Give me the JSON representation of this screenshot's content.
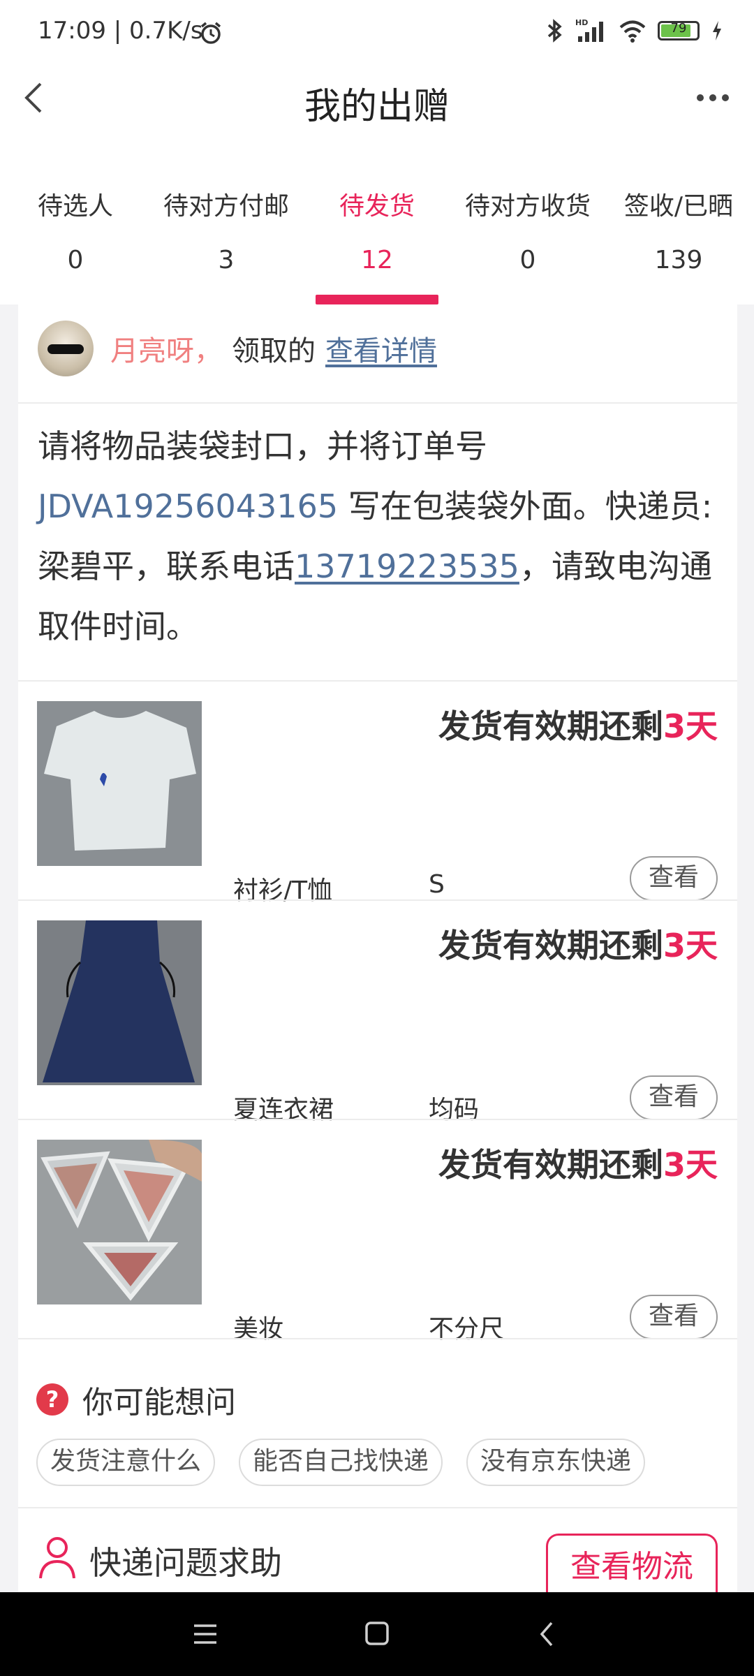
{
  "status_bar": {
    "time": "17:09 | 0.7K/s",
    "battery": "79",
    "icons": [
      "alarm-icon",
      "bluetooth-icon",
      "signal-icon",
      "wifi-icon",
      "battery-icon",
      "charging-icon"
    ]
  },
  "header": {
    "title": "我的出赠",
    "back_icon": "chevron-left-icon",
    "more_icon": "more-dots-icon"
  },
  "tabs": [
    {
      "label": "待选人",
      "count": "0",
      "active": false
    },
    {
      "label": "待对方付邮",
      "count": "3",
      "active": false
    },
    {
      "label": "待发货",
      "count": "12",
      "active": true
    },
    {
      "label": "待对方收货",
      "count": "0",
      "active": false
    },
    {
      "label": "签收/已晒",
      "count": "139",
      "active": false
    }
  ],
  "recipient": {
    "name": "月亮呀，",
    "action": "领取的",
    "detail_link": "查看详情"
  },
  "instructions": {
    "part1": "请将物品装袋封口，并将订单号 ",
    "order_number": "JDVA19256043165",
    "part2": " 写在包装袋外面。快递员:梁碧平，联系电话",
    "phone": "13719223535",
    "part3": "，请致电沟通取件时间。"
  },
  "items": [
    {
      "deadline_prefix": "发货有效期还剩",
      "deadline_days": "3天",
      "category": "衬衫/T恤",
      "size": "S",
      "view_label": "查看",
      "thumb": "white-tshirt-photo"
    },
    {
      "deadline_prefix": "发货有效期还剩",
      "deadline_days": "3天",
      "category": "夏连衣裙",
      "size": "均码",
      "view_label": "查看",
      "thumb": "navy-dress-photo"
    },
    {
      "deadline_prefix": "发货有效期还剩",
      "deadline_days": "3天",
      "category": "美妆",
      "size": "不分尺",
      "view_label": "查看",
      "thumb": "blush-palette-photo"
    }
  ],
  "faq": {
    "title": "你可能想问",
    "icon": "question-icon",
    "chips": [
      "发货注意什么",
      "能否自己找快递",
      "没有京东快递"
    ]
  },
  "help": {
    "label": "快递问题求助",
    "icon": "person-icon",
    "button": "查看物流"
  },
  "colors": {
    "accent": "#e8245a",
    "link": "#50709a",
    "name": "#f08080"
  }
}
